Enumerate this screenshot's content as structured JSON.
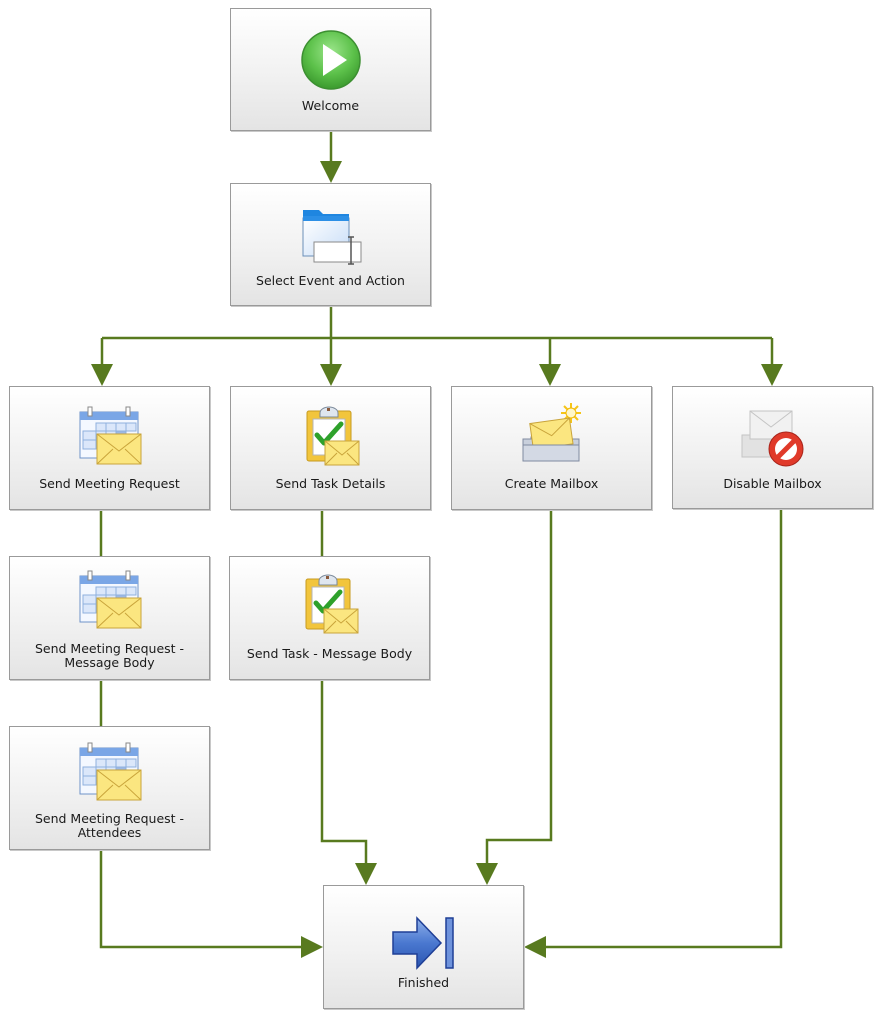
{
  "diagram": {
    "title": "",
    "colors": {
      "connector": "#587a1f",
      "node_border": "#9a9a9a",
      "node_fill_top": "#ffffff",
      "node_fill_bottom": "#e4e4e4"
    },
    "nodes": [
      {
        "id": "welcome",
        "label": "Welcome",
        "icon": "play-icon"
      },
      {
        "id": "select",
        "label": "Select Event and Action",
        "icon": "folder-form-icon"
      },
      {
        "id": "smr",
        "label": "Send Meeting Request",
        "icon": "calendar-envelope-icon"
      },
      {
        "id": "std",
        "label": "Send Task Details",
        "icon": "clipboard-envelope-icon"
      },
      {
        "id": "cmb",
        "label": "Create Mailbox",
        "icon": "new-mailbox-icon"
      },
      {
        "id": "dmb",
        "label": "Disable Mailbox",
        "icon": "disable-mailbox-icon"
      },
      {
        "id": "smr_body",
        "label": "Send Meeting Request -\nMessage Body",
        "label_lines": [
          "Send Meeting Request -",
          "Message Body"
        ],
        "icon": "calendar-envelope-icon"
      },
      {
        "id": "st_body",
        "label": "Send Task - Message Body",
        "icon": "clipboard-envelope-icon"
      },
      {
        "id": "smr_att",
        "label": "Send Meeting Request -\nAttendees",
        "label_lines": [
          "Send Meeting Request -",
          "Attendees"
        ],
        "icon": "calendar-envelope-icon"
      },
      {
        "id": "finished",
        "label": "Finished",
        "icon": "finish-arrow-icon"
      }
    ],
    "edges": [
      {
        "from": "welcome",
        "to": "select",
        "arrow": true
      },
      {
        "from": "select",
        "to": "smr",
        "arrow": true
      },
      {
        "from": "select",
        "to": "std",
        "arrow": true
      },
      {
        "from": "select",
        "to": "cmb",
        "arrow": true
      },
      {
        "from": "select",
        "to": "dmb",
        "arrow": true
      },
      {
        "from": "smr",
        "to": "smr_body",
        "arrow": false
      },
      {
        "from": "smr_body",
        "to": "smr_att",
        "arrow": false
      },
      {
        "from": "std",
        "to": "st_body",
        "arrow": false
      },
      {
        "from": "smr_att",
        "to": "finished",
        "arrow": true
      },
      {
        "from": "st_body",
        "to": "finished",
        "arrow": true
      },
      {
        "from": "cmb",
        "to": "finished",
        "arrow": true
      },
      {
        "from": "dmb",
        "to": "finished",
        "arrow": true
      }
    ]
  }
}
